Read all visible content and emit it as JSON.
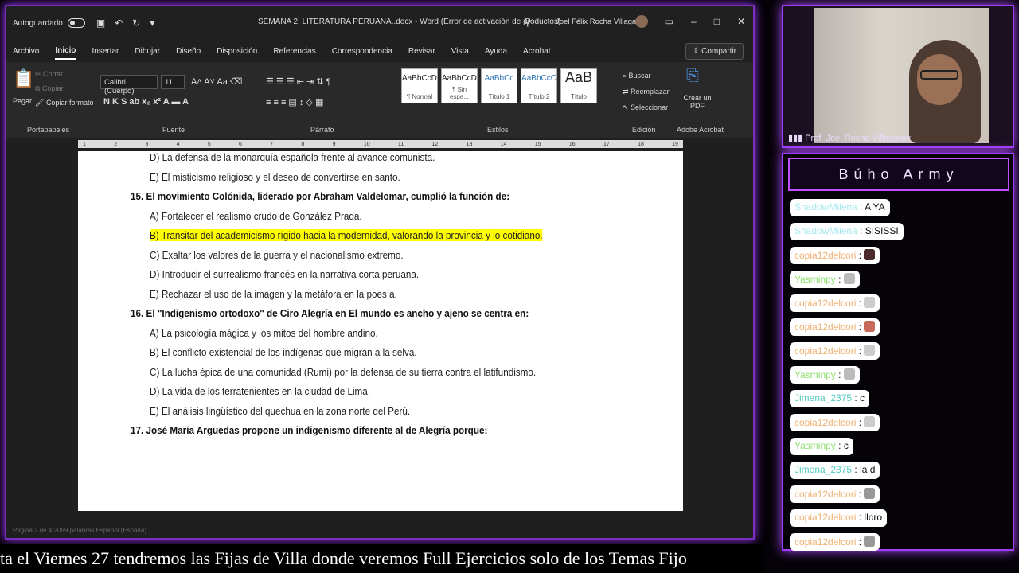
{
  "window": {
    "autosave": "Autoguardado",
    "title": "SEMANA 2. LITERATURA PERUANA..docx - Word (Error de activación de productos)",
    "user": "Joel Félix Rocha Villagaray"
  },
  "menu": [
    "Archivo",
    "Inicio",
    "Insertar",
    "Dibujar",
    "Diseño",
    "Disposición",
    "Referencias",
    "Correspondencia",
    "Revisar",
    "Vista",
    "Ayuda",
    "Acrobat"
  ],
  "share": "Compartir",
  "ribbon": {
    "paste": "Pegar",
    "cut": "Cortar",
    "copy": "Copiar",
    "format_painter": "Copiar formato",
    "font": "Calibri (Cuerpo)",
    "size": "11",
    "styles": [
      {
        "preview": "AaBbCcDc",
        "name": "¶ Normal"
      },
      {
        "preview": "AaBbCcDc",
        "name": "¶ Sin espa..."
      },
      {
        "preview": "AaBbCc",
        "name": "Título 1"
      },
      {
        "preview": "AaBbCcC",
        "name": "Título 2"
      },
      {
        "preview": "AaB",
        "name": "Título"
      }
    ],
    "find": "Buscar",
    "replace": "Reemplazar",
    "select": "Seleccionar",
    "pdf": "Crear un PDF",
    "groups": [
      "Portapapeles",
      "Fuente",
      "Párrafo",
      "Estilos",
      "Edición",
      "Adobe Acrobat"
    ]
  },
  "document": {
    "lines": [
      {
        "text": "D) La defensa de la monarquía española frente al avance comunista.",
        "q": false
      },
      {
        "text": "E) El misticismo religioso y el deseo de convertirse en santo.",
        "q": false
      },
      {
        "text": "15.  El movimiento Colónida, liderado por Abraham Valdelomar, cumplió la función de:",
        "q": true
      },
      {
        "text": "A) Fortalecer el realismo crudo de González Prada.",
        "q": false
      },
      {
        "text": "B) Transitar del academicismo rígido hacia la modernidad, valorando la provincia y lo cotidiano.",
        "q": false,
        "hl": true
      },
      {
        "text": "C) Exaltar los valores de la guerra y el nacionalismo extremo.",
        "q": false
      },
      {
        "text": "D) Introducir el surrealismo francés en la narrativa corta peruana.",
        "q": false
      },
      {
        "text": "E) Rechazar el uso de la imagen y la metáfora en la poesía.",
        "q": false
      },
      {
        "text": "16.  El \"Indigenismo ortodoxo\" de Ciro Alegría en El mundo es ancho y ajeno se centra en:",
        "q": true
      },
      {
        "text": "A) La psicología mágica y los mitos del hombre andino.",
        "q": false
      },
      {
        "text": "B) El conflicto existencial de los indígenas que migran a la selva.",
        "q": false
      },
      {
        "text": "C) La lucha épica de una comunidad (Rumi) por la defensa de su tierra contra el latifundismo.",
        "q": false
      },
      {
        "text": "D) La vida de los terratenientes en la ciudad de Lima.",
        "q": false
      },
      {
        "text": "E) El análisis lingüístico del quechua en la zona norte del Perú.",
        "q": false
      },
      {
        "text": "17.  José María Arguedas propone un indigenismo diferente al de Alegría porque:",
        "q": true
      }
    ]
  },
  "status": "Página 2 de 4   2099 palabras   Español (España)",
  "camera": {
    "name": "Prof. Joel Rocha Villagaray"
  },
  "chat": {
    "title": "Búho Army",
    "messages": [
      {
        "user": "ShadowMilena",
        "text": "A YA",
        "cls": "u-shadow"
      },
      {
        "user": "ShadowMilena",
        "text": "SISISSI",
        "cls": "u-shadow"
      },
      {
        "user": "copia12delcori",
        "text": "",
        "cls": "u-copia",
        "emote": "#4a2a2a"
      },
      {
        "user": "Yasminpy",
        "text": "",
        "cls": "u-yas",
        "emote": "#bbb"
      },
      {
        "user": "copia12delcori",
        "text": "",
        "cls": "u-copia",
        "emote": "#ccc"
      },
      {
        "user": "copia12delcori",
        "text": "",
        "cls": "u-copia",
        "emote": "#c86a5a"
      },
      {
        "user": "copia12delcori",
        "text": "",
        "cls": "u-copia",
        "emote": "#ccc"
      },
      {
        "user": "Yasminpy",
        "text": "",
        "cls": "u-yas",
        "emote": "#bbb"
      },
      {
        "user": "Jimena_2375",
        "text": "c",
        "cls": "u-jim"
      },
      {
        "user": "copia12delcori",
        "text": "",
        "cls": "u-copia",
        "emote": "#ccc"
      },
      {
        "user": "Yasminpy",
        "text": "c",
        "cls": "u-yas"
      },
      {
        "user": "Jimena_2375",
        "text": "la d",
        "cls": "u-jim"
      },
      {
        "user": "copia12delcori",
        "text": "",
        "cls": "u-copia",
        "emote": "#999"
      },
      {
        "user": "copia12delcori",
        "text": "lloro",
        "cls": "u-copia"
      },
      {
        "user": "copia12delcori",
        "text": "",
        "cls": "u-copia",
        "emote": "#999"
      }
    ]
  },
  "ticker": "ta el Viernes 27 tendremos las Fijas de Villa donde veremos Full Ejercicios solo de los Temas Fijo"
}
